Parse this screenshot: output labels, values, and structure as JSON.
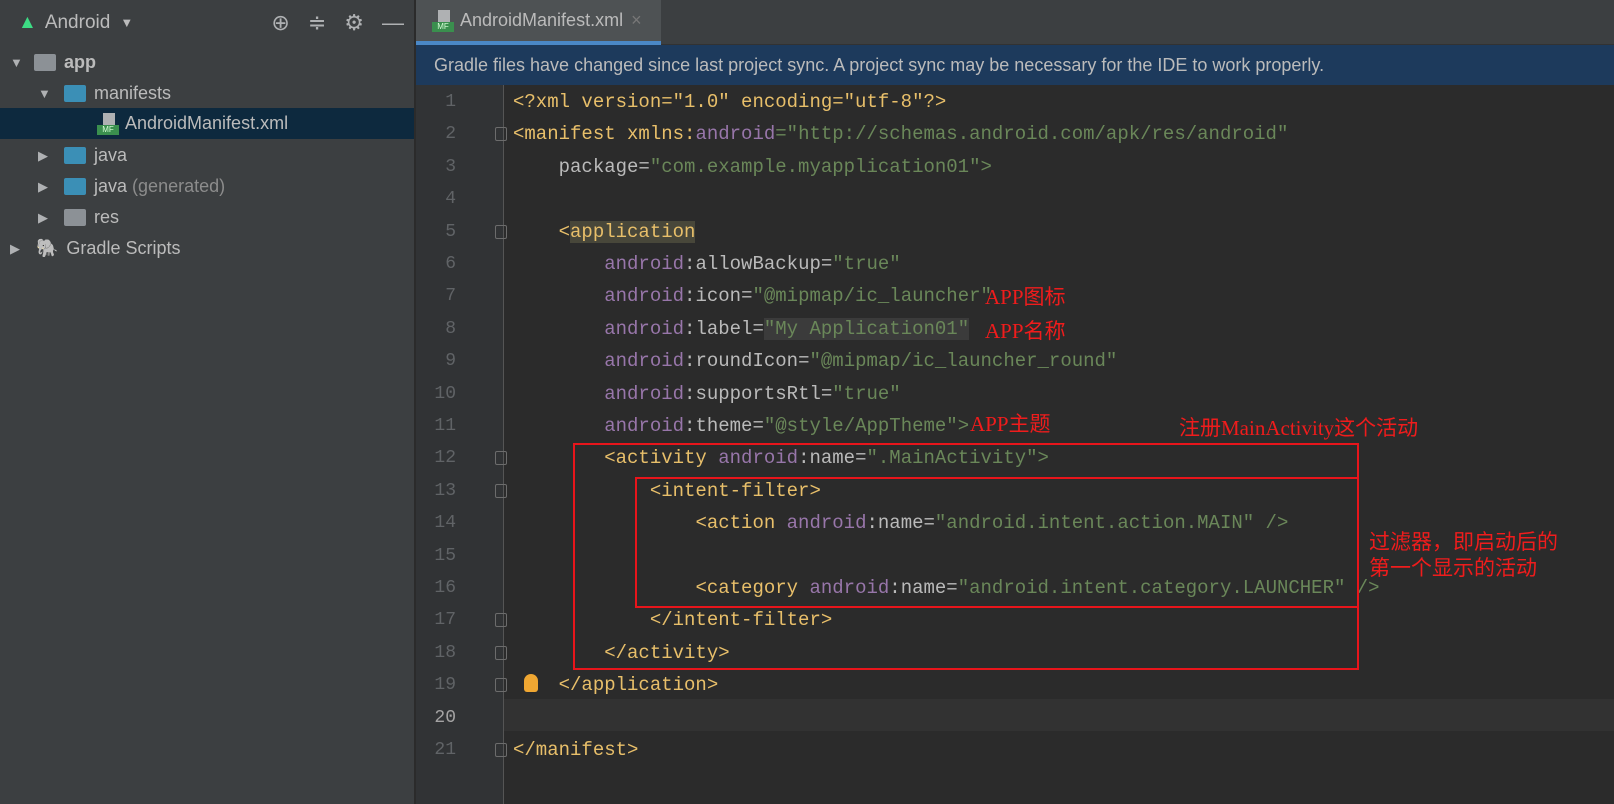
{
  "sidebar": {
    "view": "Android",
    "tree": [
      {
        "label": "app",
        "expanded": true
      },
      {
        "label": "manifests",
        "expanded": true
      },
      {
        "label": "AndroidManifest.xml",
        "selected": true
      },
      {
        "label": "java"
      },
      {
        "label": "java",
        "suffix": "(generated)"
      },
      {
        "label": "res"
      },
      {
        "label": "Gradle Scripts"
      }
    ]
  },
  "tab": {
    "label": "AndroidManifest.xml",
    "close": "×"
  },
  "banner": "Gradle files have changed since last project sync. A project sync may be necessary for the IDE to work properly.",
  "code": {
    "l1": "<?xml version=\"1.0\" encoding=\"utf-8\"?>",
    "l2a": "<manifest xmlns:",
    "l2b": "android",
    "l2c": "=\"http://schemas.android.com/apk/res/android\"",
    "l3a": "    package=",
    "l3b": "\"com.example.myapplication01\">",
    "l5a": "<",
    "l5b": "application",
    "attrs": [
      {
        "k": "allowBackup",
        "v": "\"true\""
      },
      {
        "k": "icon",
        "v": "\"@mipmap/ic_launcher\""
      },
      {
        "k": "label",
        "v": "\"My Application01\""
      },
      {
        "k": "roundIcon",
        "v": "\"@mipmap/ic_launcher_round\""
      },
      {
        "k": "supportsRtl",
        "v": "\"true\""
      },
      {
        "k": "theme",
        "v": "\"@style/AppTheme\">"
      }
    ],
    "ns": "android",
    "l12a": "<activity ",
    "l12c": ":name=",
    "l12d": "\".MainActivity\">",
    "l13": "<intent-filter>",
    "l14a": "<action ",
    "l14c": ":name=",
    "l14d": "\"android.intent.action.MAIN\" />",
    "l16a": "<category ",
    "l16c": ":name=",
    "l16d": "\"android.intent.category.LAUNCHER\" />",
    "l17": "</intent-filter>",
    "l18": "</activity>",
    "l19": "</application>",
    "l21": "</manifest>"
  },
  "annotations": {
    "icon": "APP图标",
    "label": "APP名称",
    "theme": "APP主题",
    "activity": "注册MainActivity这个活动",
    "filter1": "过滤器，即启动后的",
    "filter2": "第一个显示的活动"
  },
  "colors": {
    "annotation": "#e8151b",
    "selection": "#0d293e",
    "tab_underline": "#4a88c7"
  }
}
